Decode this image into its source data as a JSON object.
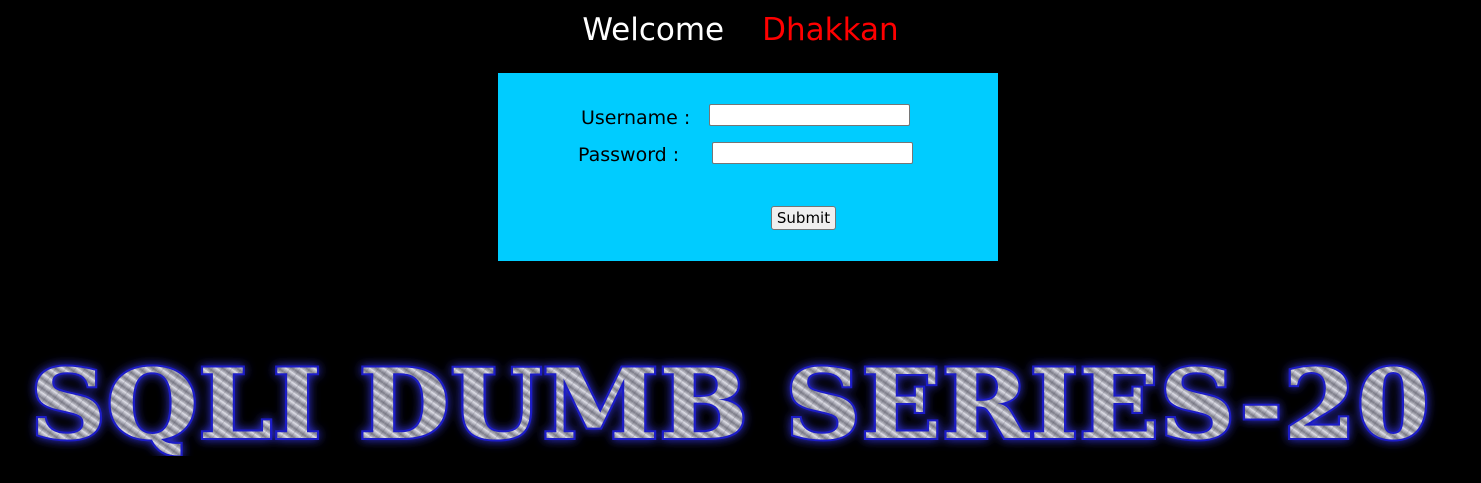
{
  "header": {
    "welcome": "Welcome",
    "user_name": "Dhakkan"
  },
  "login_form": {
    "username_label": "Username :",
    "password_label": "Password :",
    "username_value": "",
    "password_value": "",
    "submit_label": "Submit"
  },
  "banner": {
    "text": "SQLI DUMB SERIES-20"
  },
  "colors": {
    "background": "#000000",
    "form_background": "#00ccff",
    "welcome_text": "#ffffff",
    "user_name_text": "#ff0000",
    "banner_glow": "#2a2aff"
  }
}
